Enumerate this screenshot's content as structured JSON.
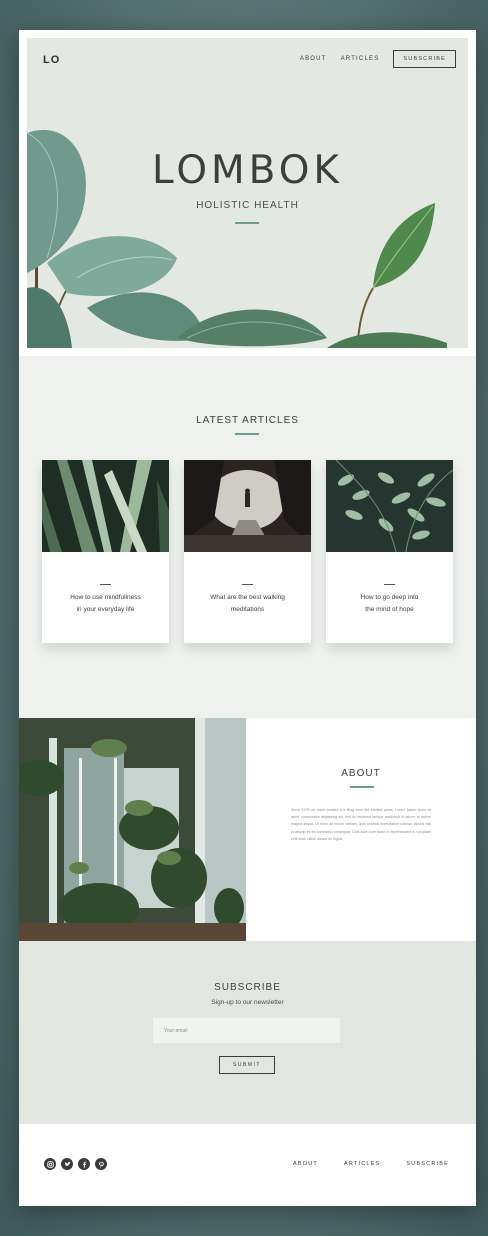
{
  "header": {
    "logo": "LO",
    "nav": [
      "ABOUT",
      "ARTICLES"
    ],
    "subscribe_label": "SUBSCRIBE"
  },
  "hero": {
    "title": "LOMBOK",
    "subtitle": "HOLISTIC HEALTH"
  },
  "articles": {
    "title": "LATEST ARTICLES",
    "items": [
      {
        "title_line1": "How to use mindfullness",
        "title_line2": "in your everyday life"
      },
      {
        "title_line1": "What are the best walking",
        "title_line2": "meditations"
      },
      {
        "title_line1": "How to go deep into",
        "title_line2": "the mind of hope"
      }
    ]
  },
  "about": {
    "title": "ABOUT",
    "body": "Since 1975 we have created a a Blog from the earliest years. Lorem ipsum dolor sit amet, consectetur adipiscing elit, sed do eiusmod tempor incididunt ut labore et dolore magna aliqua. Ut enim ad minim veniam, quis nostrud exercitation ullamco laboris nisi ut aliquip ex ea commodo consequat. Duis aute irure dolor in reprehenderit in voluptate velit esse cillum dolore eu fugiat."
  },
  "subscribe": {
    "title": "SUBSCRIBE",
    "subtitle": "Sign-up to our newsletter",
    "email_placeholder": "Your email",
    "submit_label": "SUBMIT"
  },
  "footer": {
    "social_icons": [
      "instagram-icon",
      "twitter-icon",
      "facebook-icon",
      "pinterest-icon"
    ],
    "nav": [
      "ABOUT",
      "ARTICLES",
      "SUBSCRIBE"
    ]
  },
  "colors": {
    "accent": "#6f9a90",
    "text": "#3e3f3d",
    "background_outer": "#54706f",
    "hero_bg": "#e4e8e3",
    "articles_bg": "#eef1ed",
    "subscribe_bg": "#e2e6e1"
  }
}
